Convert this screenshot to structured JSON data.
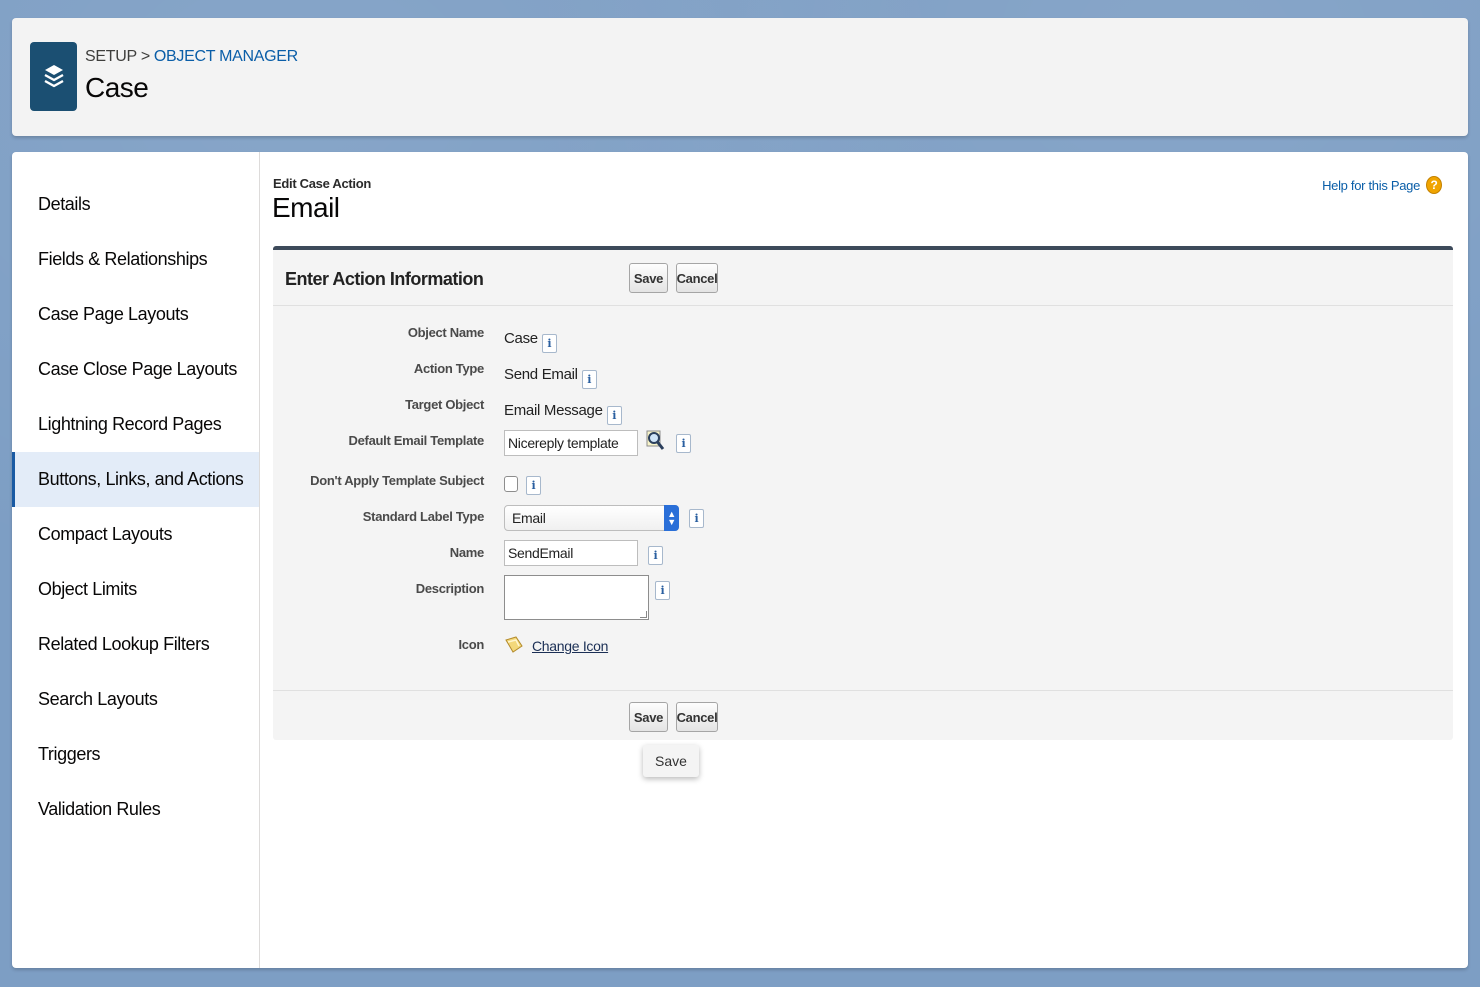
{
  "header": {
    "breadcrumb_setup": "SETUP",
    "breadcrumb_separator": ">",
    "breadcrumb_object_manager": "OBJECT MANAGER",
    "title": "Case",
    "icon": "layers-icon"
  },
  "sidebar": {
    "items": [
      {
        "label": "Details"
      },
      {
        "label": "Fields & Relationships"
      },
      {
        "label": "Case Page Layouts"
      },
      {
        "label": "Case Close Page Layouts"
      },
      {
        "label": "Lightning Record Pages"
      },
      {
        "label": "Buttons, Links, and Actions"
      },
      {
        "label": "Compact Layouts"
      },
      {
        "label": "Object Limits"
      },
      {
        "label": "Related Lookup Filters"
      },
      {
        "label": "Search Layouts"
      },
      {
        "label": "Triggers"
      },
      {
        "label": "Validation Rules"
      }
    ],
    "active": "Buttons, Links, and Actions"
  },
  "page": {
    "subtitle": "Edit Case Action",
    "title": "Email",
    "help_label": "Help for this Page",
    "help_icon_glyph": "?"
  },
  "form": {
    "section_title": "Enter Action Information",
    "save_label": "Save",
    "cancel_label": "Cancel",
    "info_glyph": "i",
    "fields": {
      "object_name": {
        "label": "Object Name",
        "value": "Case"
      },
      "action_type": {
        "label": "Action Type",
        "value": "Send Email"
      },
      "target_object": {
        "label": "Target Object",
        "value": "Email Message"
      },
      "default_email_template": {
        "label": "Default Email Template",
        "value": "Nicereply template"
      },
      "dont_apply_template_subject": {
        "label": "Don't Apply Template Subject",
        "checked": false
      },
      "standard_label_type": {
        "label": "Standard Label Type",
        "value": "Email"
      },
      "name": {
        "label": "Name",
        "value": "SendEmail"
      },
      "description": {
        "label": "Description",
        "value": ""
      },
      "icon": {
        "label": "Icon",
        "link_label": "Change Icon"
      }
    }
  },
  "tooltip": {
    "text": "Save"
  },
  "colors": {
    "background": "#7d9ec4",
    "header_icon": "#1b4f72",
    "link": "#0a5ea8",
    "active_nav": "#e3ecf8",
    "active_nav_border": "#1a5aa3",
    "help_icon": "#f0a400"
  }
}
